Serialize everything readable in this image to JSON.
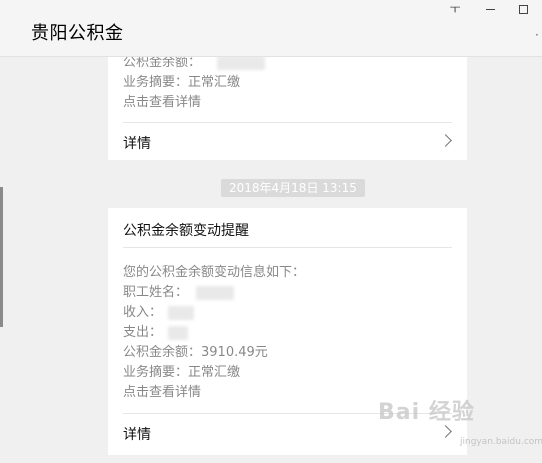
{
  "window": {
    "title": "贵阳公积金",
    "pin_glyph": "ㅜ",
    "more_glyph": "·"
  },
  "card1": {
    "lines": {
      "balance_label": "公积金余额：",
      "summary": "业务摘要：正常汇缴",
      "click_detail": "点击查看详情"
    },
    "detail_label": "详情"
  },
  "timestamp": "2018年4月18日 13:15",
  "card2": {
    "title": "公积金余额变动提醒",
    "intro": "您的公积金余额变动信息如下：",
    "name_label": "职工姓名：",
    "income_label": "收入：",
    "expense_label": "支出：",
    "balance": "公积金余额：3910.49元",
    "summary": "业务摘要：正常汇缴",
    "click_detail": "点击查看详情",
    "detail_label": "详情"
  },
  "watermark": {
    "text": "Bai 经验",
    "sub": "jingyan.baidu.com"
  },
  "colors": {
    "background": "#f0f0f0",
    "card": "#ffffff",
    "timestamp_bg": "#dadada"
  }
}
